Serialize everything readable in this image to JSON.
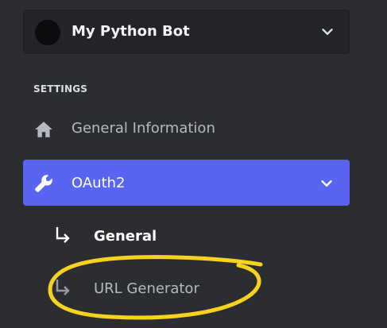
{
  "app": {
    "name": "My Python Bot",
    "expand_icon": "chevron-down-icon"
  },
  "sidebar": {
    "section_heading": "SETTINGS",
    "items": [
      {
        "label": "General Information",
        "icon": "home-icon"
      },
      {
        "label": "OAuth2",
        "icon": "wrench-icon",
        "expanded": true,
        "selected": true
      }
    ],
    "subitems": [
      {
        "label": "General",
        "icon": "subitem-arrow-icon"
      },
      {
        "label": "URL Generator",
        "icon": "subitem-arrow-icon",
        "annotated": true
      }
    ]
  },
  "colors": {
    "background": "#2b2d31",
    "accent": "#5865f2",
    "annotation": "#f7d21e"
  }
}
